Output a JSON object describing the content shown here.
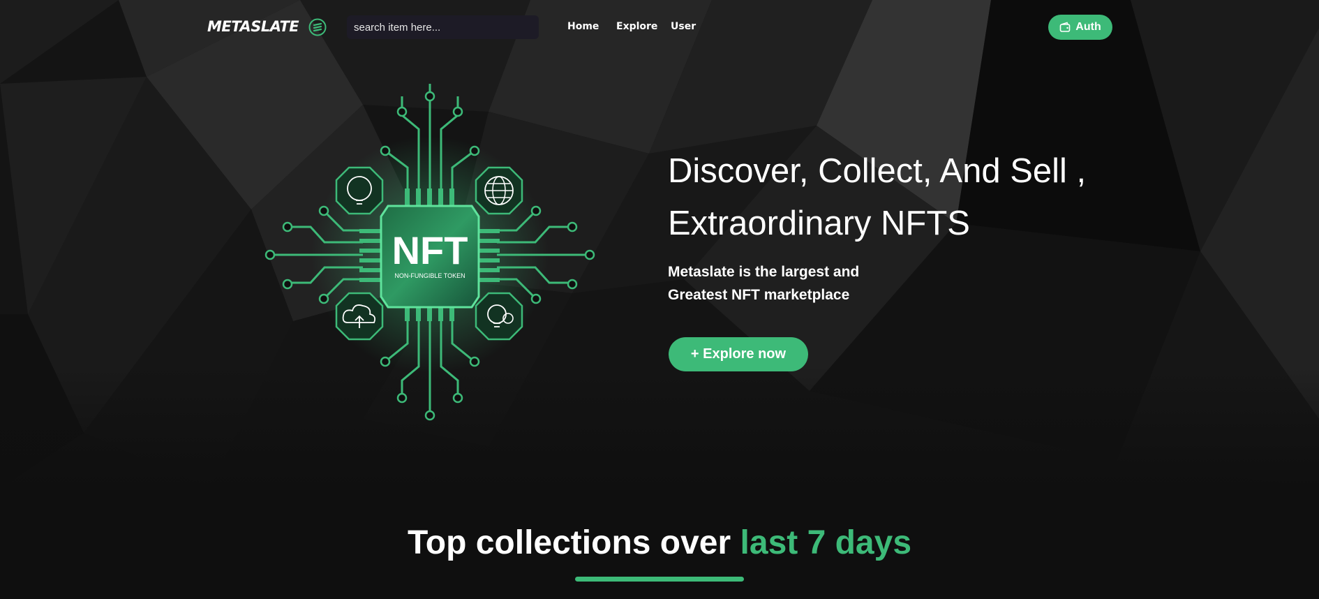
{
  "header": {
    "logo": "METASLATE",
    "search_placeholder": "search item here...",
    "nav": [
      "Home",
      "Explore",
      "User"
    ],
    "auth_label": "Auth"
  },
  "hero": {
    "title_line1": "Discover, Collect, And Sell ,",
    "title_line2": "Extraordinary NFTS",
    "subtitle_line1": "Metaslate is the largest and",
    "subtitle_line2": "Greatest NFT marketplace",
    "cta_label": "+ Explore now",
    "chip_text": "NFT",
    "chip_subtext": "NON-FUNGIBLE TOKEN"
  },
  "section": {
    "title_prefix": "Top collections over",
    "title_highlight": "last 7 days"
  },
  "colors": {
    "accent": "#3dba78",
    "background": "#0f0f0f"
  },
  "icons": [
    "wallet-icon",
    "logo-mark-icon",
    "brain-bulb-icon",
    "globe-icon",
    "cloud-upload-icon",
    "bulb-gear-icon"
  ]
}
